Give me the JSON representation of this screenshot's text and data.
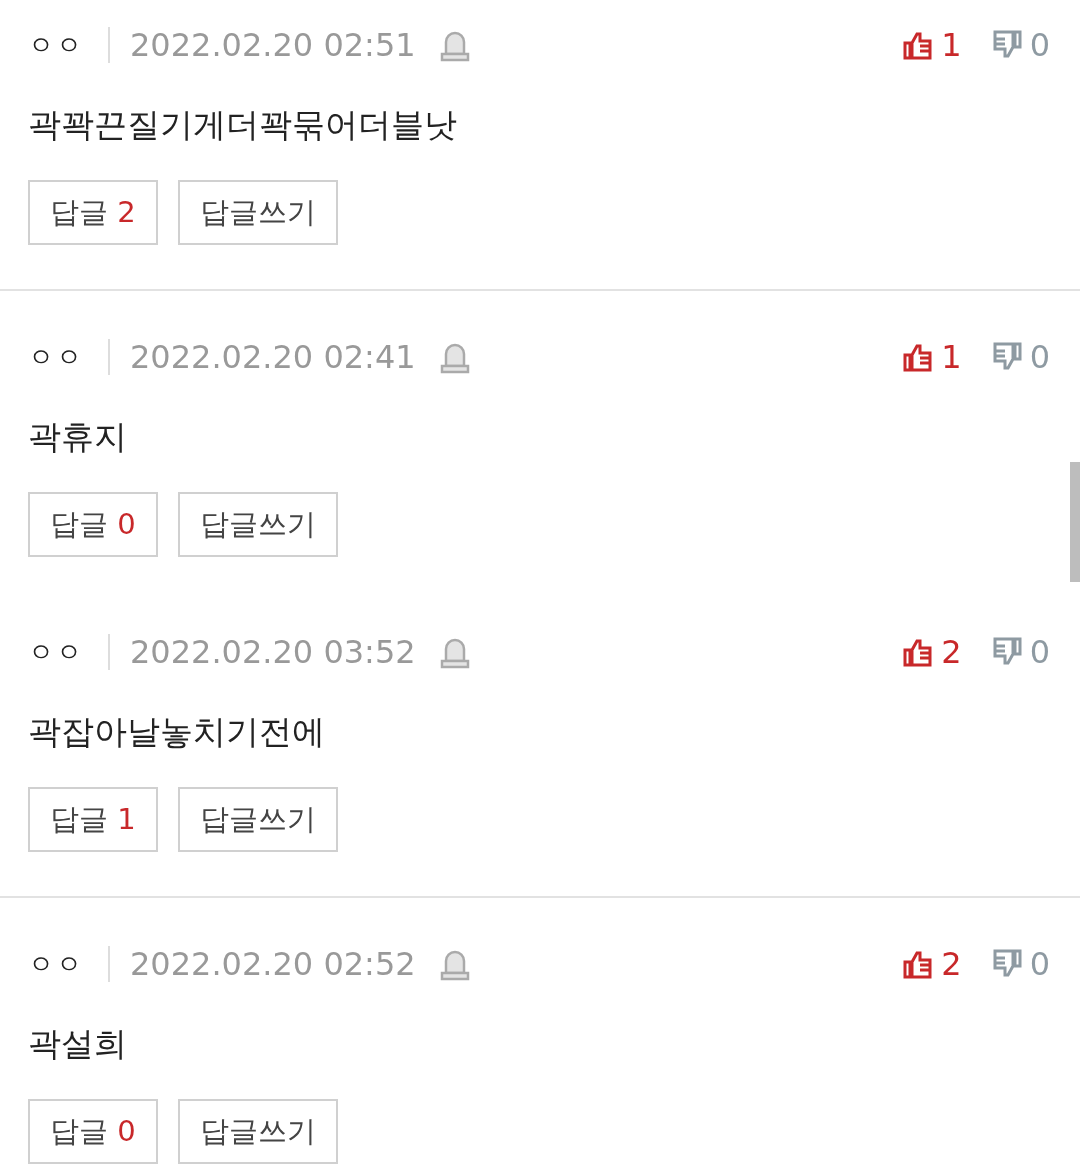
{
  "comments": [
    {
      "author": "ㅇㅇ",
      "date": "2022.02.20 02:51",
      "likes": "1",
      "dislikes": "0",
      "text": "곽꽉끈질기게더꽉묶어더블낫",
      "reply_label": "답글",
      "reply_count": "2",
      "write_label": "답글쓰기",
      "separated": true
    },
    {
      "author": "ㅇㅇ",
      "date": "2022.02.20 02:41",
      "likes": "1",
      "dislikes": "0",
      "text": "곽휴지",
      "reply_label": "답글",
      "reply_count": "0",
      "write_label": "답글쓰기",
      "separated": false
    },
    {
      "author": "ㅇㅇ",
      "date": "2022.02.20 03:52",
      "likes": "2",
      "dislikes": "0",
      "text": "곽잡아날놓치기전에",
      "reply_label": "답글",
      "reply_count": "1",
      "write_label": "답글쓰기",
      "separated": true
    },
    {
      "author": "ㅇㅇ",
      "date": "2022.02.20 02:52",
      "likes": "2",
      "dislikes": "0",
      "text": "곽설희",
      "reply_label": "답글",
      "reply_count": "0",
      "write_label": "답글쓰기",
      "separated": false
    }
  ]
}
